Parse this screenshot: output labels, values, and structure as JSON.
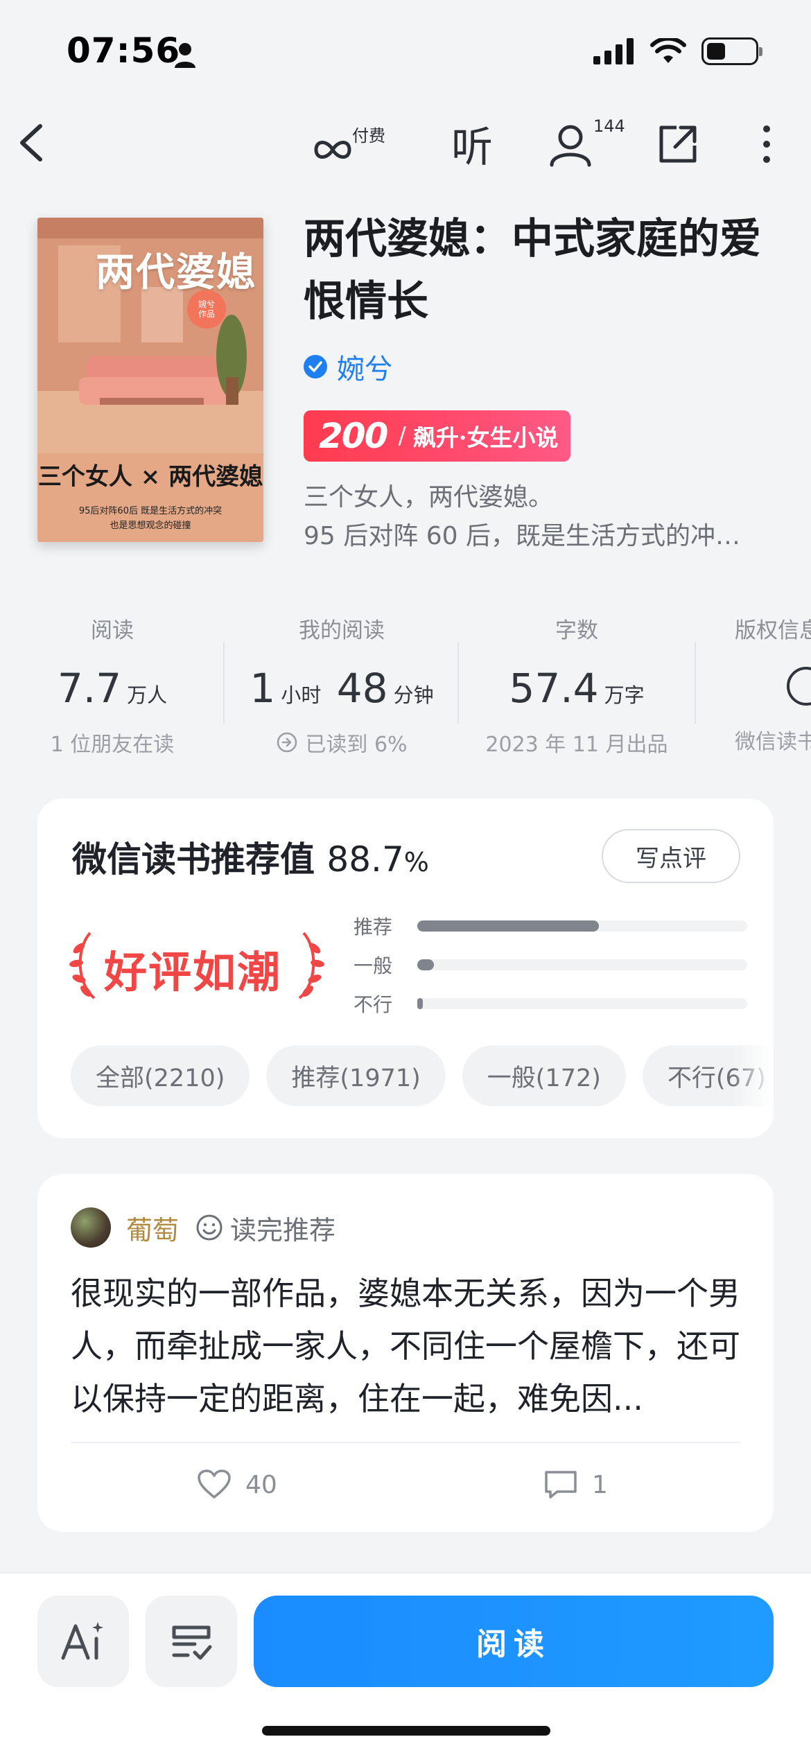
{
  "status_bar": {
    "time": "07:56"
  },
  "toolbar": {
    "pay_label": "付费",
    "listen_label": "听",
    "readers_count": "144"
  },
  "book": {
    "cover": {
      "title": "两代婆媳",
      "seal": "婉兮\n作品",
      "line1": "三个女人 × 两代婆媳",
      "line2": "95后对阵60后   既是生活方式的冲突\n也是思想观念的碰撞"
    },
    "title": "两代婆媳：中式家庭的爱恨情长",
    "author": "婉兮",
    "rank_num": "200",
    "rank_text": "飙升·女生小说",
    "intro_line1": "三个女人，两代婆媳。",
    "intro_line2": "95 后对阵 60 后，既是生活方式的冲…"
  },
  "stats": [
    {
      "label": "阅读",
      "value": "7.7",
      "unit": "万人",
      "sub": "1 位朋友在读"
    },
    {
      "label": "我的阅读",
      "value_h": "1",
      "unit_h": "小时",
      "value_m": "48",
      "unit_m": "分钟",
      "sub": "已读到 6%"
    },
    {
      "label": "字数",
      "value": "57.4",
      "unit": "万字",
      "sub": "2023 年 11 月出品"
    },
    {
      "label": "版权信息",
      "sub": "微信读书"
    }
  ],
  "recommend": {
    "title": "微信读书推荐值",
    "value": "88.7",
    "unit": "%",
    "write_review": "写点评",
    "badge": "好评如潮",
    "bars": [
      {
        "label": "推荐",
        "fraction": 0.55
      },
      {
        "label": "一般",
        "fraction": 0.05
      },
      {
        "label": "不行",
        "fraction": 0.015
      }
    ],
    "filters": [
      "全部(2210)",
      "推荐(1971)",
      "一般(172)",
      "不行(67)"
    ]
  },
  "review": {
    "user": "葡萄",
    "tag": "读完推荐",
    "text": "很现实的一部作品，婆媳本无关系，因为一个男人，而牵扯成一家人，不同住一个屋檐下，还可以保持一定的距离，住在一起，难免因...",
    "likes": "40",
    "comments": "1"
  },
  "bottom": {
    "read_label": "阅读"
  },
  "colors": {
    "accent": "#1e7ff0",
    "rank": "#ff3b4e",
    "badge": "#f04646"
  }
}
